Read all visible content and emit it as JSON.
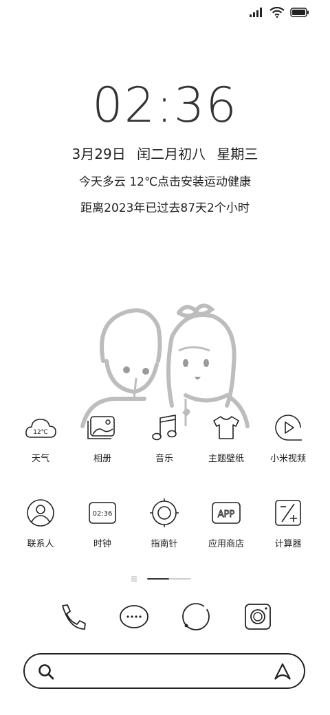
{
  "status_bar": {
    "icons": [
      "signal-icon",
      "wifi-icon",
      "battery-icon"
    ]
  },
  "lockscreen": {
    "time": "02:36",
    "date": "3月29日  闰二月初八  星期三",
    "weather": "今天多云 12℃点击安装运动健康",
    "countdown": "距离2023年已过去87天2个小时"
  },
  "apps_row1": [
    {
      "label": "天气",
      "icon": "weather-icon",
      "icon_text": "12℃"
    },
    {
      "label": "相册",
      "icon": "gallery-icon"
    },
    {
      "label": "音乐",
      "icon": "music-icon"
    },
    {
      "label": "主题壁纸",
      "icon": "theme-icon"
    },
    {
      "label": "小米视频",
      "icon": "video-icon"
    }
  ],
  "apps_row2": [
    {
      "label": "联系人",
      "icon": "contacts-icon"
    },
    {
      "label": "时钟",
      "icon": "clock-icon",
      "icon_text": "02:36"
    },
    {
      "label": "指南针",
      "icon": "compass-icon"
    },
    {
      "label": "应用商店",
      "icon": "app-store-icon",
      "icon_text": "APP"
    },
    {
      "label": "计算器",
      "icon": "calculator-icon"
    }
  ],
  "dock": [
    "phone-icon",
    "messages-icon",
    "browser-icon",
    "camera-icon"
  ],
  "search": {
    "placeholder": ""
  },
  "colors": {
    "ink": "#222222",
    "background": "#ffffff",
    "pager_active": "#333333",
    "pager_inactive": "#cccccc"
  }
}
